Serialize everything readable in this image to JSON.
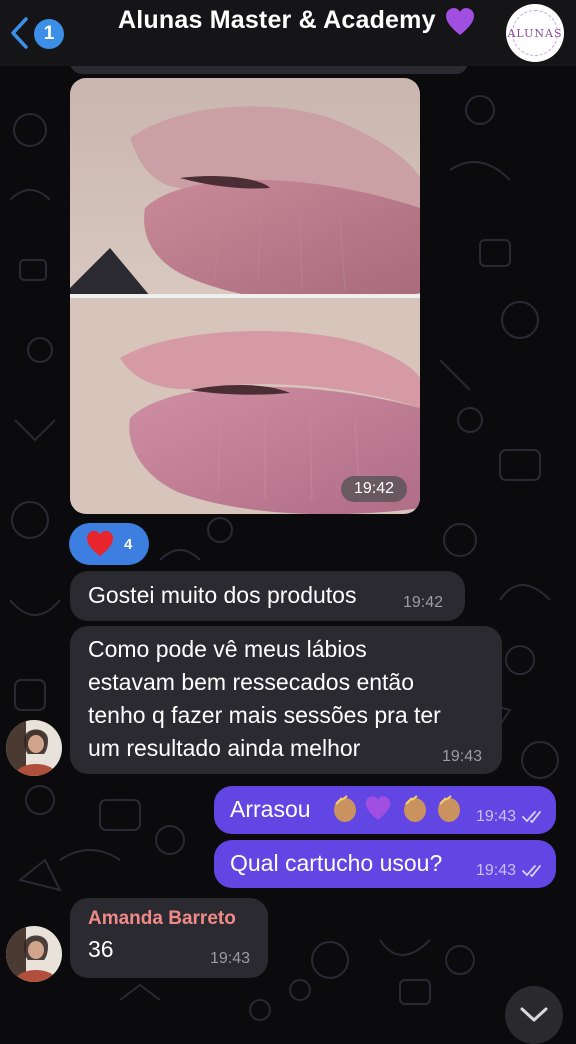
{
  "header": {
    "title": "Alunas Master & Academy",
    "unread_count": "1",
    "group_logo_text": "ALUNAS"
  },
  "messages": {
    "photo": {
      "time": "19:42",
      "reaction_count": "4"
    },
    "msg1": {
      "text": "Gostei muito dos produtos",
      "time": "19:42"
    },
    "msg2": {
      "lines": [
        "Como pode vê meus lábios",
        "estavam bem ressecados então",
        "tenho q fazer mais sessões pra ter",
        "um resultado ainda melhor"
      ],
      "time": "19:43"
    },
    "out1": {
      "text": "Arrasou",
      "time": "19:43"
    },
    "out2": {
      "text": "Qual cartucho usou?",
      "time": "19:43"
    },
    "msg3": {
      "sender": "Amanda Barreto",
      "text": "36",
      "time": "19:43"
    }
  },
  "colors": {
    "outgoing_bubble": "#6246e4",
    "incoming_bubble": "#2b2a30",
    "accent": "#3b8fe6",
    "sender_name": "#f08a88"
  },
  "icons": [
    "chevron-left-icon",
    "purple-heart-icon",
    "red-heart-icon",
    "clap-icon",
    "double-check-icon",
    "chevron-down-icon"
  ]
}
